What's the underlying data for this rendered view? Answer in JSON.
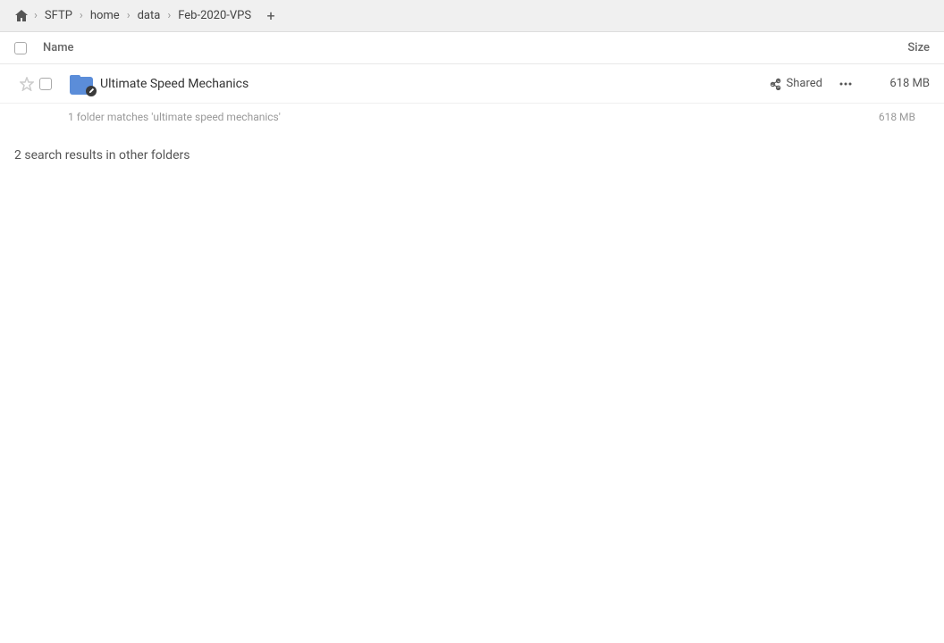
{
  "breadcrumb": {
    "home_icon": "home",
    "items": [
      {
        "label": "SFTP",
        "id": "sftp"
      },
      {
        "label": "home",
        "id": "home"
      },
      {
        "label": "data",
        "id": "data"
      },
      {
        "label": "Feb-2020-VPS",
        "id": "feb-2020-vps"
      }
    ],
    "add_label": "+"
  },
  "table": {
    "header": {
      "name_label": "Name",
      "size_label": "Size"
    },
    "rows": [
      {
        "name": "Ultimate Speed Mechanics",
        "shared_label": "Shared",
        "size": "618 MB",
        "starred": false
      }
    ],
    "search_summary": "1 folder matches 'ultimate speed mechanics'",
    "search_summary_size": "618 MB",
    "other_results_label": "2 search results in other folders"
  }
}
